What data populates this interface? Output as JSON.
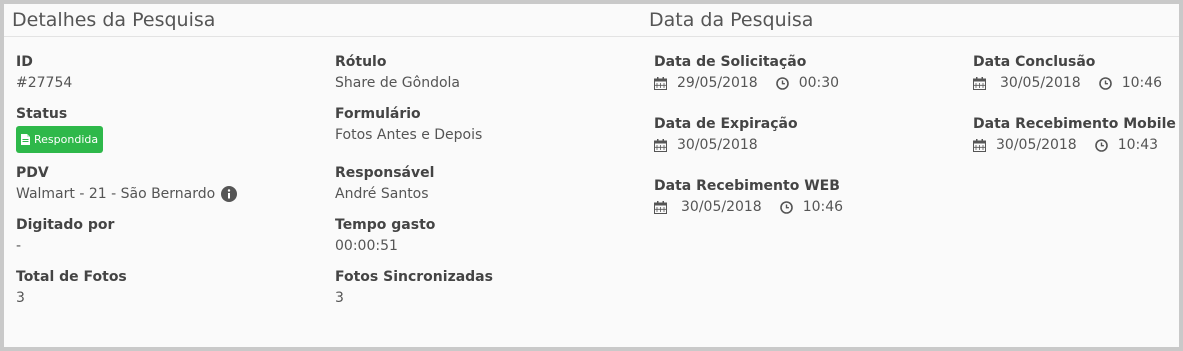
{
  "left": {
    "title": "Detalhes da Pesquisa",
    "id_label": "ID",
    "id_value": "#27754",
    "status_label": "Status",
    "status_value": "Respondida",
    "pdv_label": "PDV",
    "pdv_value": "Walmart - 21 - São Bernardo",
    "digitado_label": "Digitado por",
    "digitado_value": "-",
    "total_label": "Total de Fotos",
    "total_value": "3",
    "rotulo_label": "Rótulo",
    "rotulo_value": "Share de Gôndola",
    "form_label": "Formulário",
    "form_value": "Fotos Antes e Depois",
    "resp_label": "Responsável",
    "resp_value": "André Santos",
    "tempo_label": "Tempo gasto",
    "tempo_value": "00:00:51",
    "sinc_label": "Fotos Sincronizadas",
    "sinc_value": "3"
  },
  "right": {
    "title": "Data da Pesquisa",
    "solicitacao_label": "Data de Solicitação",
    "solicitacao_date": "29/05/2018",
    "solicitacao_time": "00:30",
    "expiracao_label": "Data de Expiração",
    "expiracao_date": "30/05/2018",
    "web_label": "Data Recebimento WEB",
    "web_date": "30/05/2018",
    "web_time": "10:46",
    "conclusao_label": "Data Conclusão",
    "conclusao_date": "30/05/2018",
    "conclusao_time": "10:46",
    "mobile_label": "Data Recebimento Mobile",
    "mobile_date": "30/05/2018",
    "mobile_time": "10:43"
  },
  "colors": {
    "status_badge": "#2eb84a",
    "background": "#fafafa",
    "frame": "#c9c9c9"
  },
  "icons": [
    "calendar-icon",
    "clock-icon",
    "info-icon",
    "document-icon"
  ]
}
